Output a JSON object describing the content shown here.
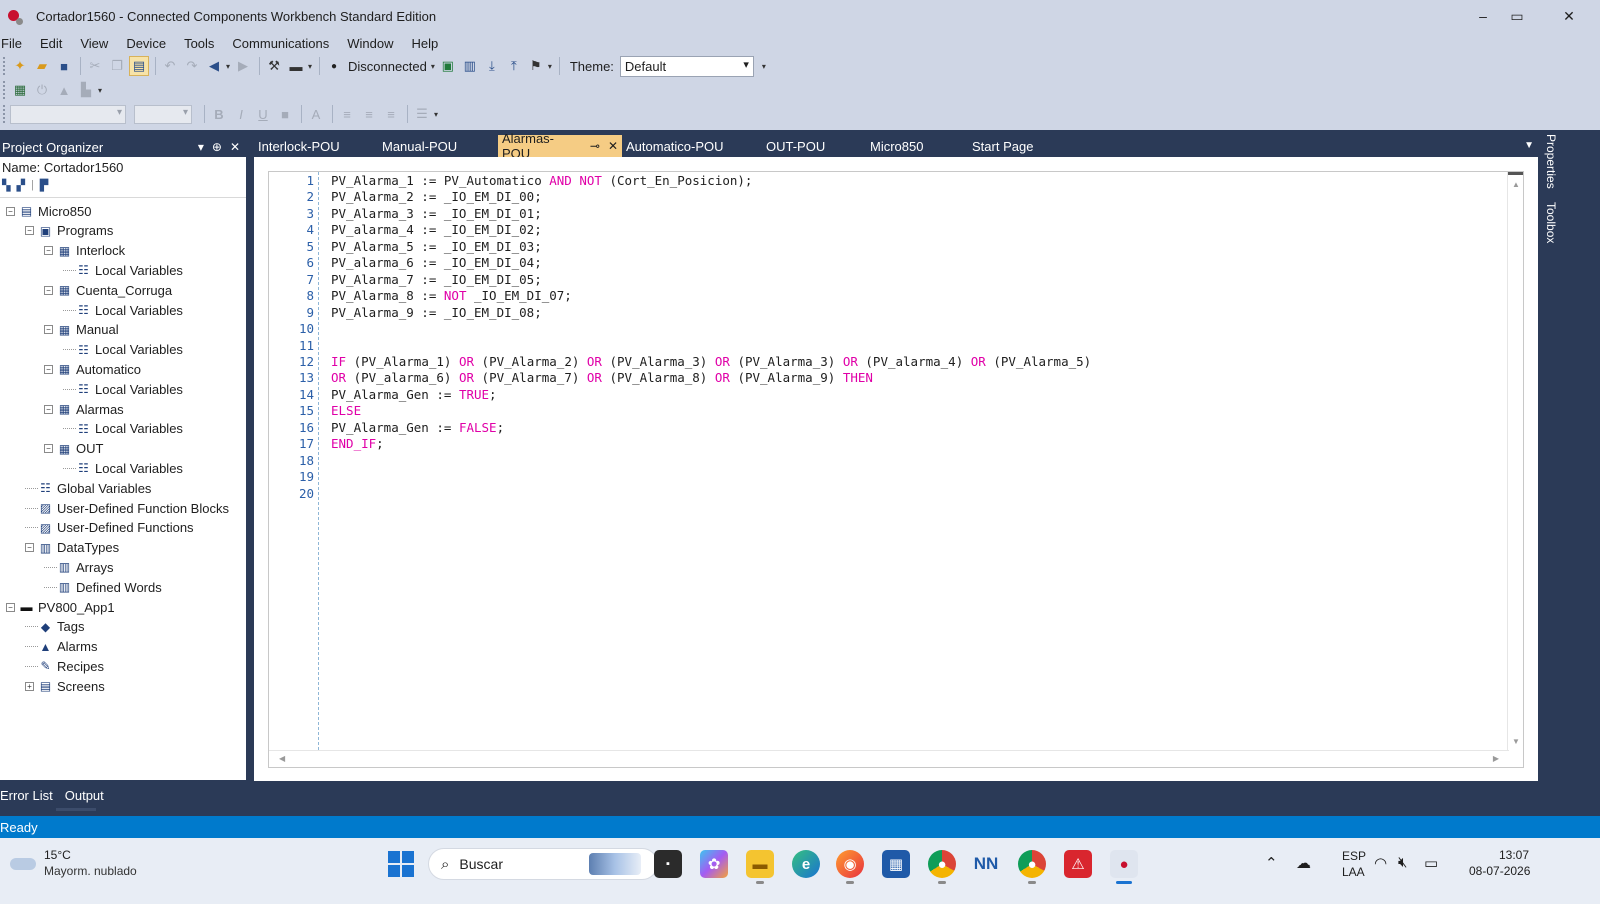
{
  "window": {
    "title": "Cortador1560 - Connected Components Workbench Standard Edition",
    "minimize": "–",
    "maximize": "▭",
    "close": "✕"
  },
  "menu": [
    "File",
    "Edit",
    "View",
    "Device",
    "Tools",
    "Communications",
    "Window",
    "Help"
  ],
  "toolbar": {
    "connection_status": "Disconnected",
    "theme_label": "Theme:",
    "theme_value": "Default"
  },
  "project_organizer": {
    "header": "Project Organizer",
    "pin": "⊕",
    "close": "✕",
    "name_line": "Name:  Cortador1560",
    "tree": [
      {
        "label": "Micro850",
        "icon": "controller-icon"
      },
      {
        "label": "Programs",
        "icon": "programs-icon"
      },
      {
        "label": "Interlock",
        "icon": "program-icon"
      },
      {
        "label": "Local Variables",
        "icon": "variables-icon"
      },
      {
        "label": "Cuenta_Corruga",
        "icon": "program-icon"
      },
      {
        "label": "Local Variables",
        "icon": "variables-icon"
      },
      {
        "label": "Manual",
        "icon": "program-icon"
      },
      {
        "label": "Local Variables",
        "icon": "variables-icon"
      },
      {
        "label": "Automatico",
        "icon": "program-icon"
      },
      {
        "label": "Local Variables",
        "icon": "variables-icon"
      },
      {
        "label": "Alarmas",
        "icon": "program-icon"
      },
      {
        "label": "Local Variables",
        "icon": "variables-icon"
      },
      {
        "label": "OUT",
        "icon": "program-icon"
      },
      {
        "label": "Local Variables",
        "icon": "variables-icon"
      },
      {
        "label": "Global Variables",
        "icon": "variables-icon"
      },
      {
        "label": "User-Defined Function Blocks",
        "icon": "udfb-icon"
      },
      {
        "label": "User-Defined Functions",
        "icon": "udf-icon"
      },
      {
        "label": "DataTypes",
        "icon": "datatypes-icon"
      },
      {
        "label": "Arrays",
        "icon": "arrays-icon"
      },
      {
        "label": "Defined Words",
        "icon": "defined-words-icon"
      },
      {
        "label": "PV800_App1",
        "icon": "hmi-icon"
      },
      {
        "label": "Tags",
        "icon": "tag-icon"
      },
      {
        "label": "Alarms",
        "icon": "bell-icon"
      },
      {
        "label": "Recipes",
        "icon": "recipe-icon"
      },
      {
        "label": "Screens",
        "icon": "screens-icon"
      }
    ]
  },
  "tabs": [
    {
      "label": "Interlock-POU"
    },
    {
      "label": "Manual-POU"
    },
    {
      "label": "Alarmas-POU",
      "active": true
    },
    {
      "label": "Automatico-POU"
    },
    {
      "label": "OUT-POU"
    },
    {
      "label": "Micro850"
    },
    {
      "label": "Start Page"
    }
  ],
  "side_tabs": [
    "Properties",
    "Toolbox"
  ],
  "editor": {
    "line_numbers": [
      "1",
      "2",
      "3",
      "4",
      "5",
      "6",
      "7",
      "8",
      "9",
      "10",
      "11",
      "12",
      "13",
      "14",
      "15",
      "16",
      "17",
      "18",
      "19",
      "20"
    ],
    "lines": [
      [
        {
          "t": "PV_Alarma_1 := PV_Automatico "
        },
        {
          "t": "AND",
          "k": 1
        },
        {
          "t": " "
        },
        {
          "t": "NOT",
          "k": 1
        },
        {
          "t": " (Cort_En_Posicion);"
        }
      ],
      [
        {
          "t": "PV_Alarma_2 := _IO_EM_DI_00;"
        }
      ],
      [
        {
          "t": "PV_Alarma_3 := _IO_EM_DI_01;"
        }
      ],
      [
        {
          "t": "PV_alarma_4 := _IO_EM_DI_02;"
        }
      ],
      [
        {
          "t": "PV_Alarma_5 := _IO_EM_DI_03;"
        }
      ],
      [
        {
          "t": "PV_alarma_6 := _IO_EM_DI_04;"
        }
      ],
      [
        {
          "t": "PV_Alarma_7 := _IO_EM_DI_05;"
        }
      ],
      [
        {
          "t": "PV_Alarma_8 := "
        },
        {
          "t": "NOT",
          "k": 1
        },
        {
          "t": " _IO_EM_DI_07;"
        }
      ],
      [
        {
          "t": "PV_Alarma_9 := _IO_EM_DI_08;"
        }
      ],
      [],
      [],
      [
        {
          "t": "IF",
          "k": 1
        },
        {
          "t": " (PV_Alarma_1) "
        },
        {
          "t": "OR",
          "k": 1
        },
        {
          "t": " (PV_Alarma_2) "
        },
        {
          "t": "OR",
          "k": 1
        },
        {
          "t": " (PV_Alarma_3) "
        },
        {
          "t": "OR",
          "k": 1
        },
        {
          "t": " (PV_Alarma_3) "
        },
        {
          "t": "OR",
          "k": 1
        },
        {
          "t": " (PV_alarma_4) "
        },
        {
          "t": "OR",
          "k": 1
        },
        {
          "t": " (PV_Alarma_5)"
        }
      ],
      [
        {
          "t": "OR",
          "k": 1
        },
        {
          "t": " (PV_alarma_6) "
        },
        {
          "t": "OR",
          "k": 1
        },
        {
          "t": " (PV_Alarma_7) "
        },
        {
          "t": "OR",
          "k": 1
        },
        {
          "t": " (PV_Alarma_8) "
        },
        {
          "t": "OR",
          "k": 1
        },
        {
          "t": " (PV_Alarma_9) "
        },
        {
          "t": "THEN",
          "k": 1
        }
      ],
      [
        {
          "t": "PV_Alarma_Gen := "
        },
        {
          "t": "TRUE",
          "k": 1
        },
        {
          "t": ";"
        }
      ],
      [
        {
          "t": "ELSE",
          "k": 1
        }
      ],
      [
        {
          "t": "PV_Alarma_Gen := "
        },
        {
          "t": "FALSE",
          "k": 1
        },
        {
          "t": ";"
        }
      ],
      [
        {
          "t": "END_IF",
          "k": 1
        },
        {
          "t": ";"
        }
      ],
      [],
      [],
      []
    ]
  },
  "bottom_tabs": [
    "Error List",
    "Output"
  ],
  "status": "Ready",
  "taskbar": {
    "temperature": "15°C",
    "weather": "Mayorm. nublado",
    "search_placeholder": "Buscar",
    "lang_1": "ESP",
    "lang_2": "LAA",
    "time": "13:07",
    "date": "08-07-2026",
    "nn_label": "NN"
  },
  "colors": {
    "frame": "#2b3a57",
    "status_bar": "#007acc",
    "active_tab": "#f5cc84",
    "keyword": "#e000a8"
  }
}
